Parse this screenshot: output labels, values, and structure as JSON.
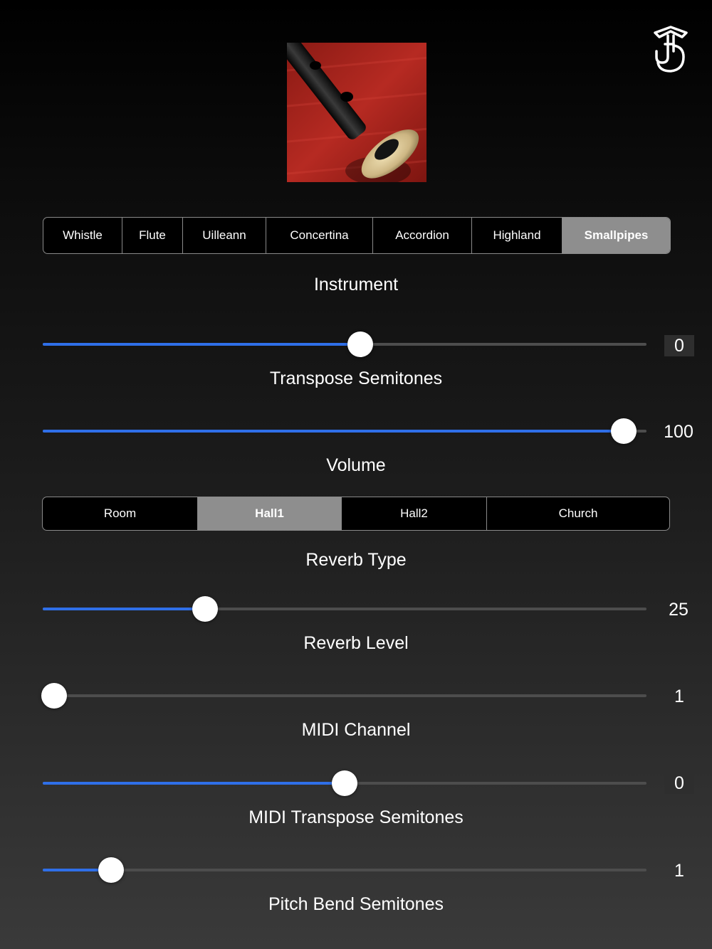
{
  "instrument_segments": {
    "items": [
      "Whistle",
      "Flute",
      "Uilleann",
      "Concertina",
      "Accordion",
      "Highland",
      "Smallpipes"
    ],
    "selected": "Smallpipes"
  },
  "instrument_label": "Instrument",
  "reverb_segments": {
    "items": [
      "Room",
      "Hall1",
      "Hall2",
      "Church"
    ],
    "selected": "Hall1"
  },
  "sliders": [
    {
      "label": "Transpose Semitones",
      "value": "0",
      "fraction": 0.527
    },
    {
      "label": "Volume",
      "value": "100",
      "fraction": 0.98
    },
    {
      "label": "Reverb Type",
      "value": "",
      "fraction": null
    },
    {
      "label": "Reverb Level",
      "value": "25",
      "fraction": 0.26
    },
    {
      "label": "MIDI Channel",
      "value": "1",
      "fraction": 0.0
    },
    {
      "label": "MIDI Transpose Semitones",
      "value": "0",
      "fraction": 0.5
    },
    {
      "label": "Pitch Bend Semitones",
      "value": "1",
      "fraction": 0.098
    }
  ],
  "colors": {
    "accent": "#2f6fe8",
    "selected_segment": "#8e8e8e",
    "track": "#4d4d4d"
  },
  "icons": {
    "logo": "app-logo-icon",
    "instrument_image": "smallpipes-chanter-image"
  }
}
